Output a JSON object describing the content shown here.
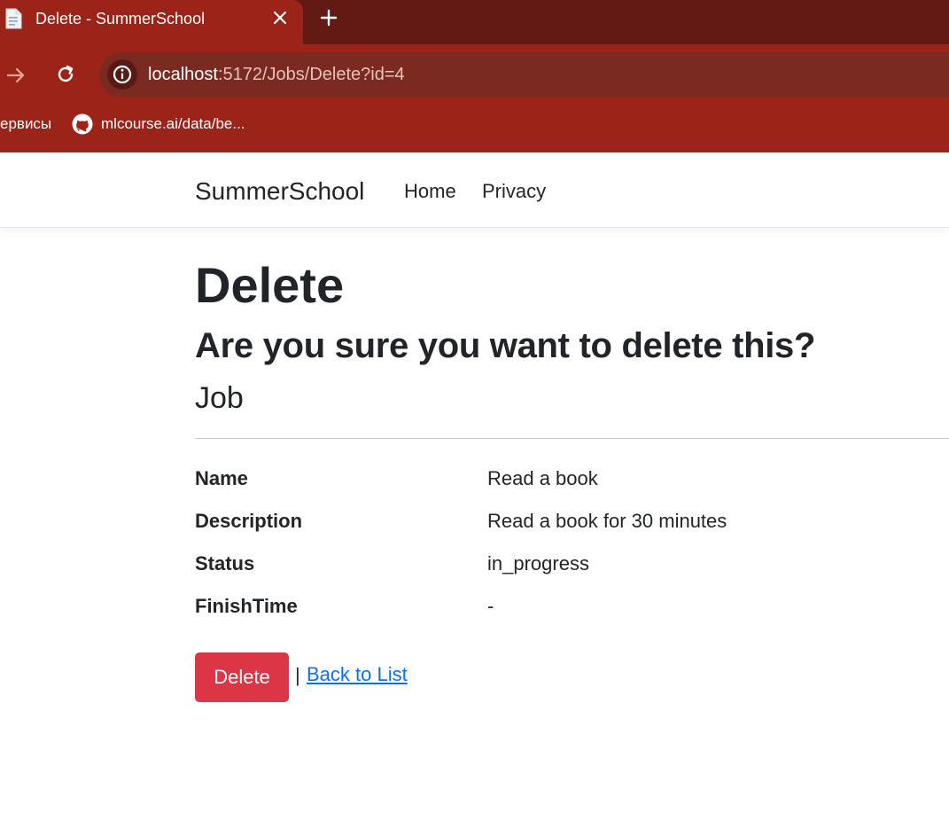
{
  "browser": {
    "tab": {
      "title": "Delete - SummerSchool"
    },
    "address_bar": {
      "host": "localhost",
      "path": ":5172/Jobs/Delete?id=4"
    },
    "bookmarks": [
      {
        "label": "ервисы"
      },
      {
        "label": "mlcourse.ai/data/be..."
      }
    ]
  },
  "navbar": {
    "brand": "SummerSchool",
    "links": [
      {
        "label": "Home"
      },
      {
        "label": "Privacy"
      }
    ]
  },
  "main": {
    "title": "Delete",
    "confirm_question": "Are you sure you want to delete this?",
    "entity_name": "Job",
    "fields": [
      {
        "label": "Name",
        "value": "Read a book"
      },
      {
        "label": "Description",
        "value": "Read a book for 30 minutes"
      },
      {
        "label": "Status",
        "value": "in_progress"
      },
      {
        "label": "FinishTime",
        "value": "-"
      }
    ],
    "actions": {
      "delete_label": "Delete",
      "separator": "|",
      "back_label": "Back to List"
    }
  },
  "colors": {
    "chrome_bg": "#9b2318",
    "tabstrip_bg": "#641a14",
    "danger": "#dc3545",
    "link": "#0d6efd",
    "text": "#212529"
  },
  "icons": {
    "favicon": "document-icon",
    "close": "close-icon",
    "new_tab": "plus-icon",
    "forward": "arrow-right-icon",
    "reload": "reload-icon",
    "site_info": "info-icon",
    "github": "github-icon"
  }
}
